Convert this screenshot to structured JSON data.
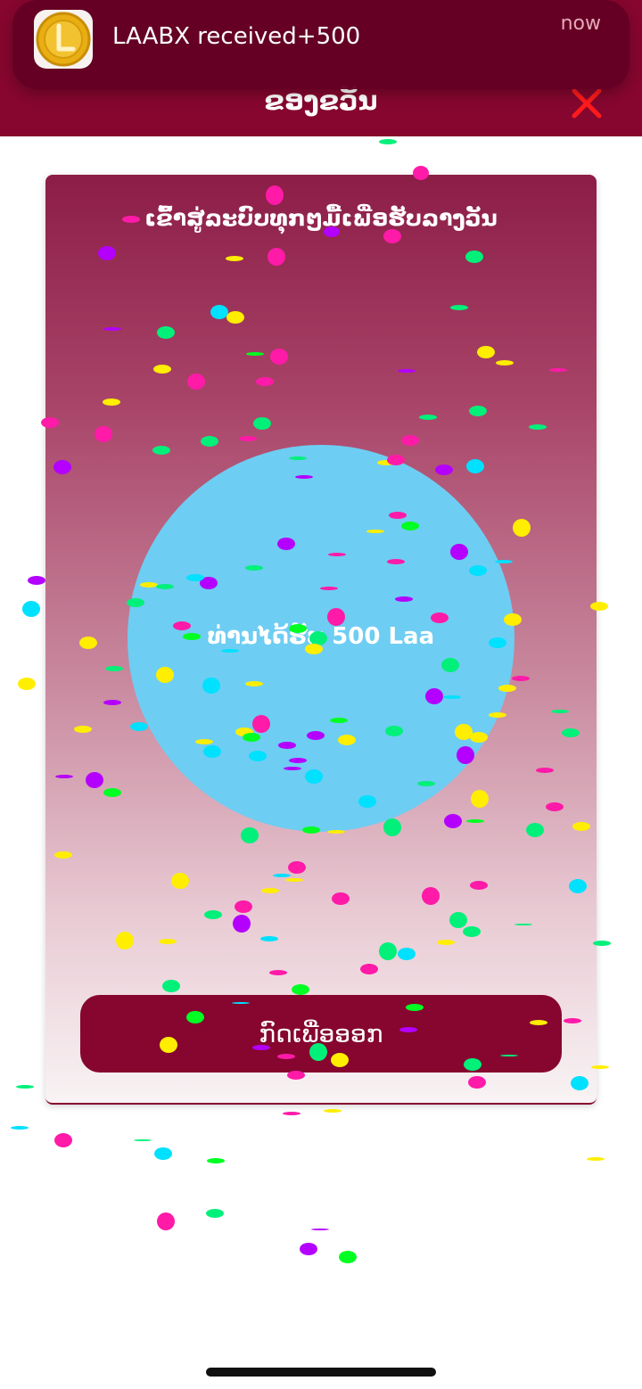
{
  "header": {
    "title": "ຂອງຂວັນ",
    "close_icon": "close-x-icon",
    "background": "#86062f",
    "close_color": "#ff1b1b"
  },
  "notification": {
    "app_icon": "laabx-coin-icon",
    "message": "LAABX received+500",
    "time": "now"
  },
  "card": {
    "heading": "ເຂົ້າສູ່ລະບົບທຸກໆມື້ເພື່ອຮັບລາງວັນ",
    "reward_text": "ທ່ານໄດ້ຮັບ 500 Laa",
    "button_label": "ກົດເພື່ອອອກ",
    "circle_color": "#6ecdf2"
  },
  "confetti_colors": [
    "#ff1aa8",
    "#ffee00",
    "#00f07a",
    "#00e0ff",
    "#b400ff",
    "#00ff22"
  ]
}
